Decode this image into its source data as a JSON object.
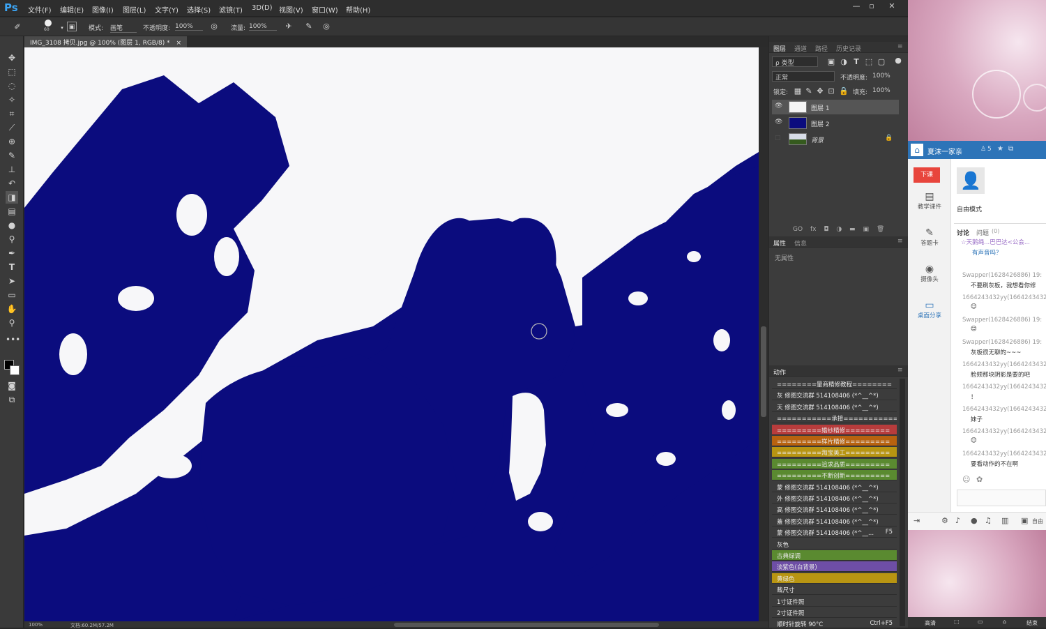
{
  "app": {
    "logo": "Ps"
  },
  "menu": [
    "文件(F)",
    "编辑(E)",
    "图像(I)",
    "图层(L)",
    "文字(Y)",
    "选择(S)",
    "滤镜(T)",
    "3D(D)",
    "视图(V)",
    "窗口(W)",
    "帮助(H)"
  ],
  "window_controls": [
    "—",
    "▫",
    "✕"
  ],
  "options": {
    "brush_size": "60",
    "mode_label": "模式:",
    "mode_value": "画笔",
    "opacity_label": "不透明度:",
    "opacity_value": "100%",
    "flow_label": "流量:",
    "flow_value": "100%"
  },
  "document": {
    "tab_title": "IMG_3108 拷贝.jpg @ 100% (图层 1, RGB/8) *",
    "close": "×",
    "zoom": "100%",
    "doc_info": "文档:60.2M/57.2M",
    "fg_color": "#000000",
    "bg_color": "#ffffff",
    "fill_color": "#0b0c7e"
  },
  "panels": {
    "layers": {
      "tabs": [
        "图层",
        "通道",
        "路径",
        "历史记录"
      ],
      "filter": "ρ 类型",
      "blend_mode": "正常",
      "opacity_label": "不透明度:",
      "opacity_value": "100%",
      "lock_label": "锁定:",
      "fill_label": "填充:",
      "fill_value": "100%",
      "items": [
        {
          "name": "图层 1",
          "visible": true
        },
        {
          "name": "图层 2",
          "visible": true
        },
        {
          "name": "背景",
          "visible": false,
          "locked": true
        }
      ],
      "footer": [
        "GO",
        "fx",
        "◘",
        "◑",
        "▬",
        "▣",
        "🗑"
      ]
    },
    "properties": {
      "tabs": [
        "属性",
        "信息"
      ],
      "empty": "无属性"
    },
    "actions": {
      "tab": "动作",
      "items": [
        {
          "label": "========暈商精修教程========",
          "color": ""
        },
        {
          "label": "灰 修图交流群 514108406 (*^__^*)",
          "color": ""
        },
        {
          "label": "天 修图交流群 514108406 (*^__^*)",
          "color": ""
        },
        {
          "label": "===========承接===========",
          "color": ""
        },
        {
          "label": "=========婚纱精修=========",
          "color": "#b83c3c"
        },
        {
          "label": "=========样片精修=========",
          "color": "#b8620f"
        },
        {
          "label": "=========淘宝美工=========",
          "color": "#b89512"
        },
        {
          "label": "=========追求品质=========",
          "color": "#5a8a30"
        },
        {
          "label": "=========不断创新=========",
          "color": "#5a8a30"
        },
        {
          "label": "蒙 修图交流群 514108406 (*^__^*)",
          "color": ""
        },
        {
          "label": "外 修图交流群 514108406 (*^__^*)",
          "color": ""
        },
        {
          "label": "高 修图交流群 514108406 (*^__^*)",
          "color": ""
        },
        {
          "label": "蓋 修图交流群 514108406 (*^__^*)",
          "color": ""
        },
        {
          "label": "蒙 修图交流群 514108406 (*^__...",
          "color": "",
          "shortcut": "F5"
        },
        {
          "label": "灰色",
          "color": ""
        },
        {
          "label": "古典绿调",
          "color": "#5a8a30"
        },
        {
          "label": "淡紫色(白背景)",
          "color": "#6e4ea6"
        },
        {
          "label": "黄绿色",
          "color": "#b89512"
        },
        {
          "label": "裁尺寸",
          "color": ""
        },
        {
          "label": "1寸证件照",
          "color": ""
        },
        {
          "label": "2寸证件照",
          "color": ""
        },
        {
          "label": "顺时针旋转 90°C",
          "color": "",
          "shortcut": "Ctrl+F5"
        }
      ]
    }
  },
  "chat": {
    "group_name": "夏沫一家亲",
    "member_count": "5",
    "end_class_btn": "下课",
    "nav": [
      "教学课件",
      "答题卡",
      "摄像头",
      "桌面分享"
    ],
    "mode": "自由模式",
    "tabs": [
      "讨论",
      "问题"
    ],
    "question_count": "(0)",
    "notice": "☆天鹅绳...巴巴达<公会...",
    "notice2": "有声音吗？",
    "messages": [
      {
        "user": "Swapper(1628426886) 19:",
        "text": "不要刷灰板，我想看你修"
      },
      {
        "user": "1664243432yy(1664243432",
        "text": ""
      },
      {
        "user": "Swapper(1628426886) 19:",
        "text": ""
      },
      {
        "user": "Swapper(1628426886) 19:",
        "text": "灰板很无聊的~~~"
      },
      {
        "user": "1664243432yy(1664243432",
        "text": "脸颊那块阴影是要的吧"
      },
      {
        "user": "1664243432yy(1664243432",
        "text": "！"
      },
      {
        "user": "1664243432yy(1664243432",
        "text": "妹子"
      },
      {
        "user": "1664243432yy(1664243432",
        "text": ""
      },
      {
        "user": "1664243432yy(1664243432",
        "text": "要看动作的不在啊"
      }
    ],
    "bottom_bar": [
      "高清",
      "结束"
    ],
    "toolbar_label": "自由"
  }
}
